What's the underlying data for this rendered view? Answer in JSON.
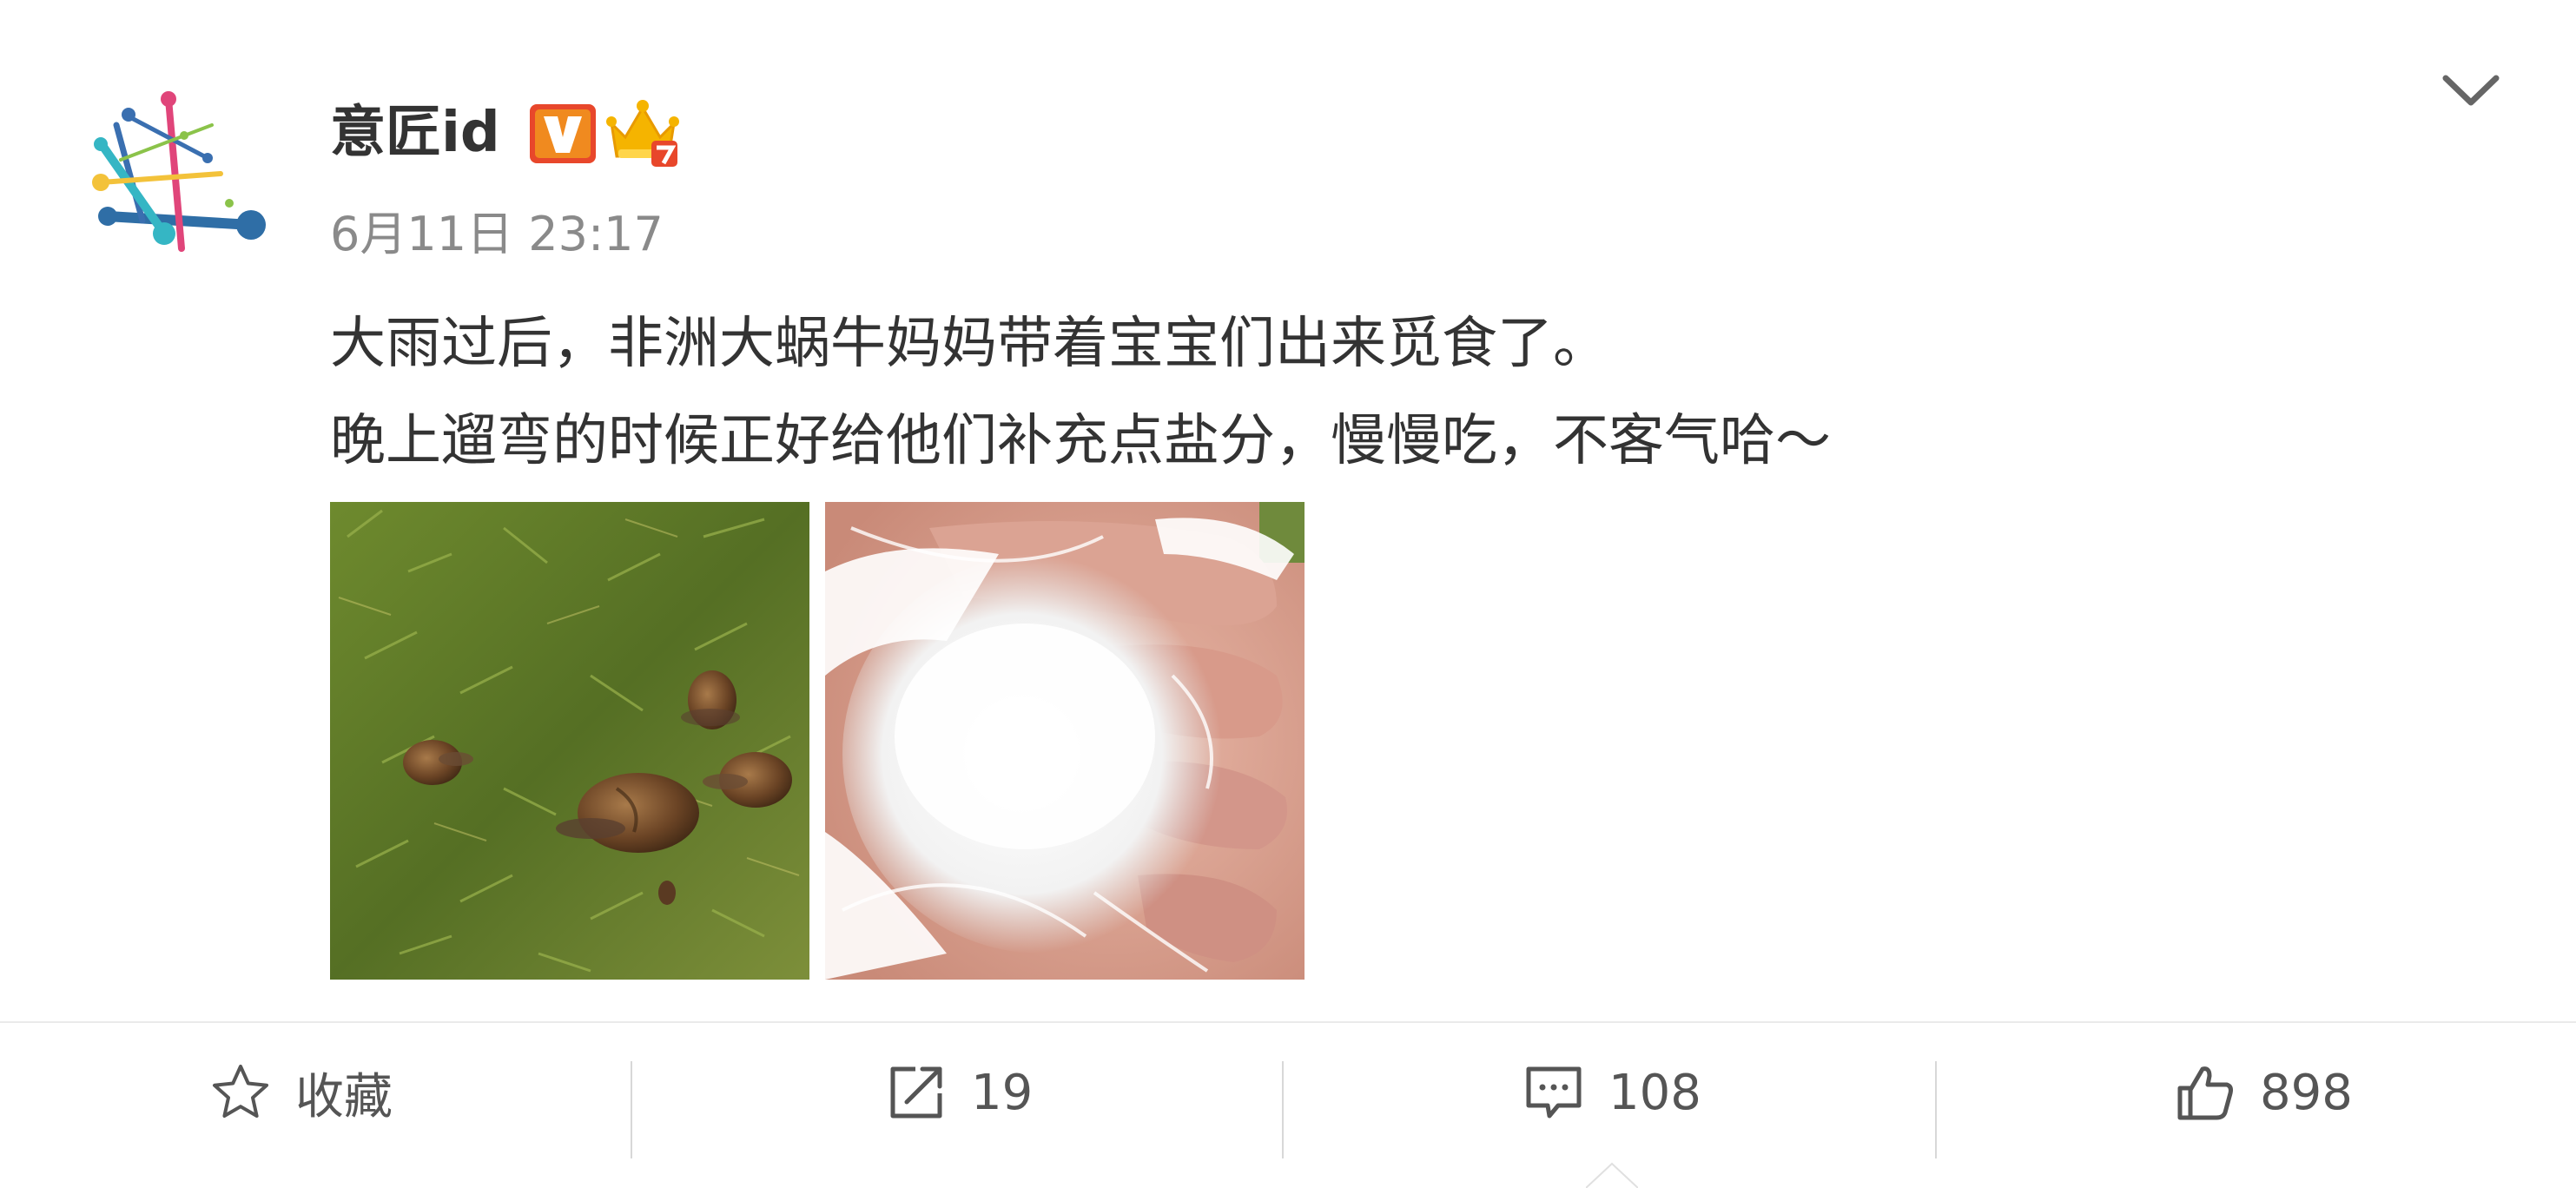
{
  "author": {
    "name": "意匠id",
    "badges": [
      "verified-v-icon",
      "vip-crown-icon"
    ],
    "avatar": "colorful-network-logo"
  },
  "post": {
    "timestamp": "6月11日 23:17",
    "lines": [
      "大雨过后，非洲大蜗牛妈妈带着宝宝们出来觅食了。",
      "晚上遛弯的时候正好给他们补充点盐分，慢慢吃，不客气哈～"
    ],
    "images": [
      "snails-on-grass-photo",
      "salt-in-plastic-bag-photo"
    ]
  },
  "actions": {
    "favorite_label": "收藏",
    "repost_count": "19",
    "comment_count": "108",
    "like_count": "898"
  },
  "colors": {
    "text": "#333333",
    "secondary": "#8a8a8a",
    "verified_badge": "#e8472b",
    "crown": "#f5b400"
  }
}
